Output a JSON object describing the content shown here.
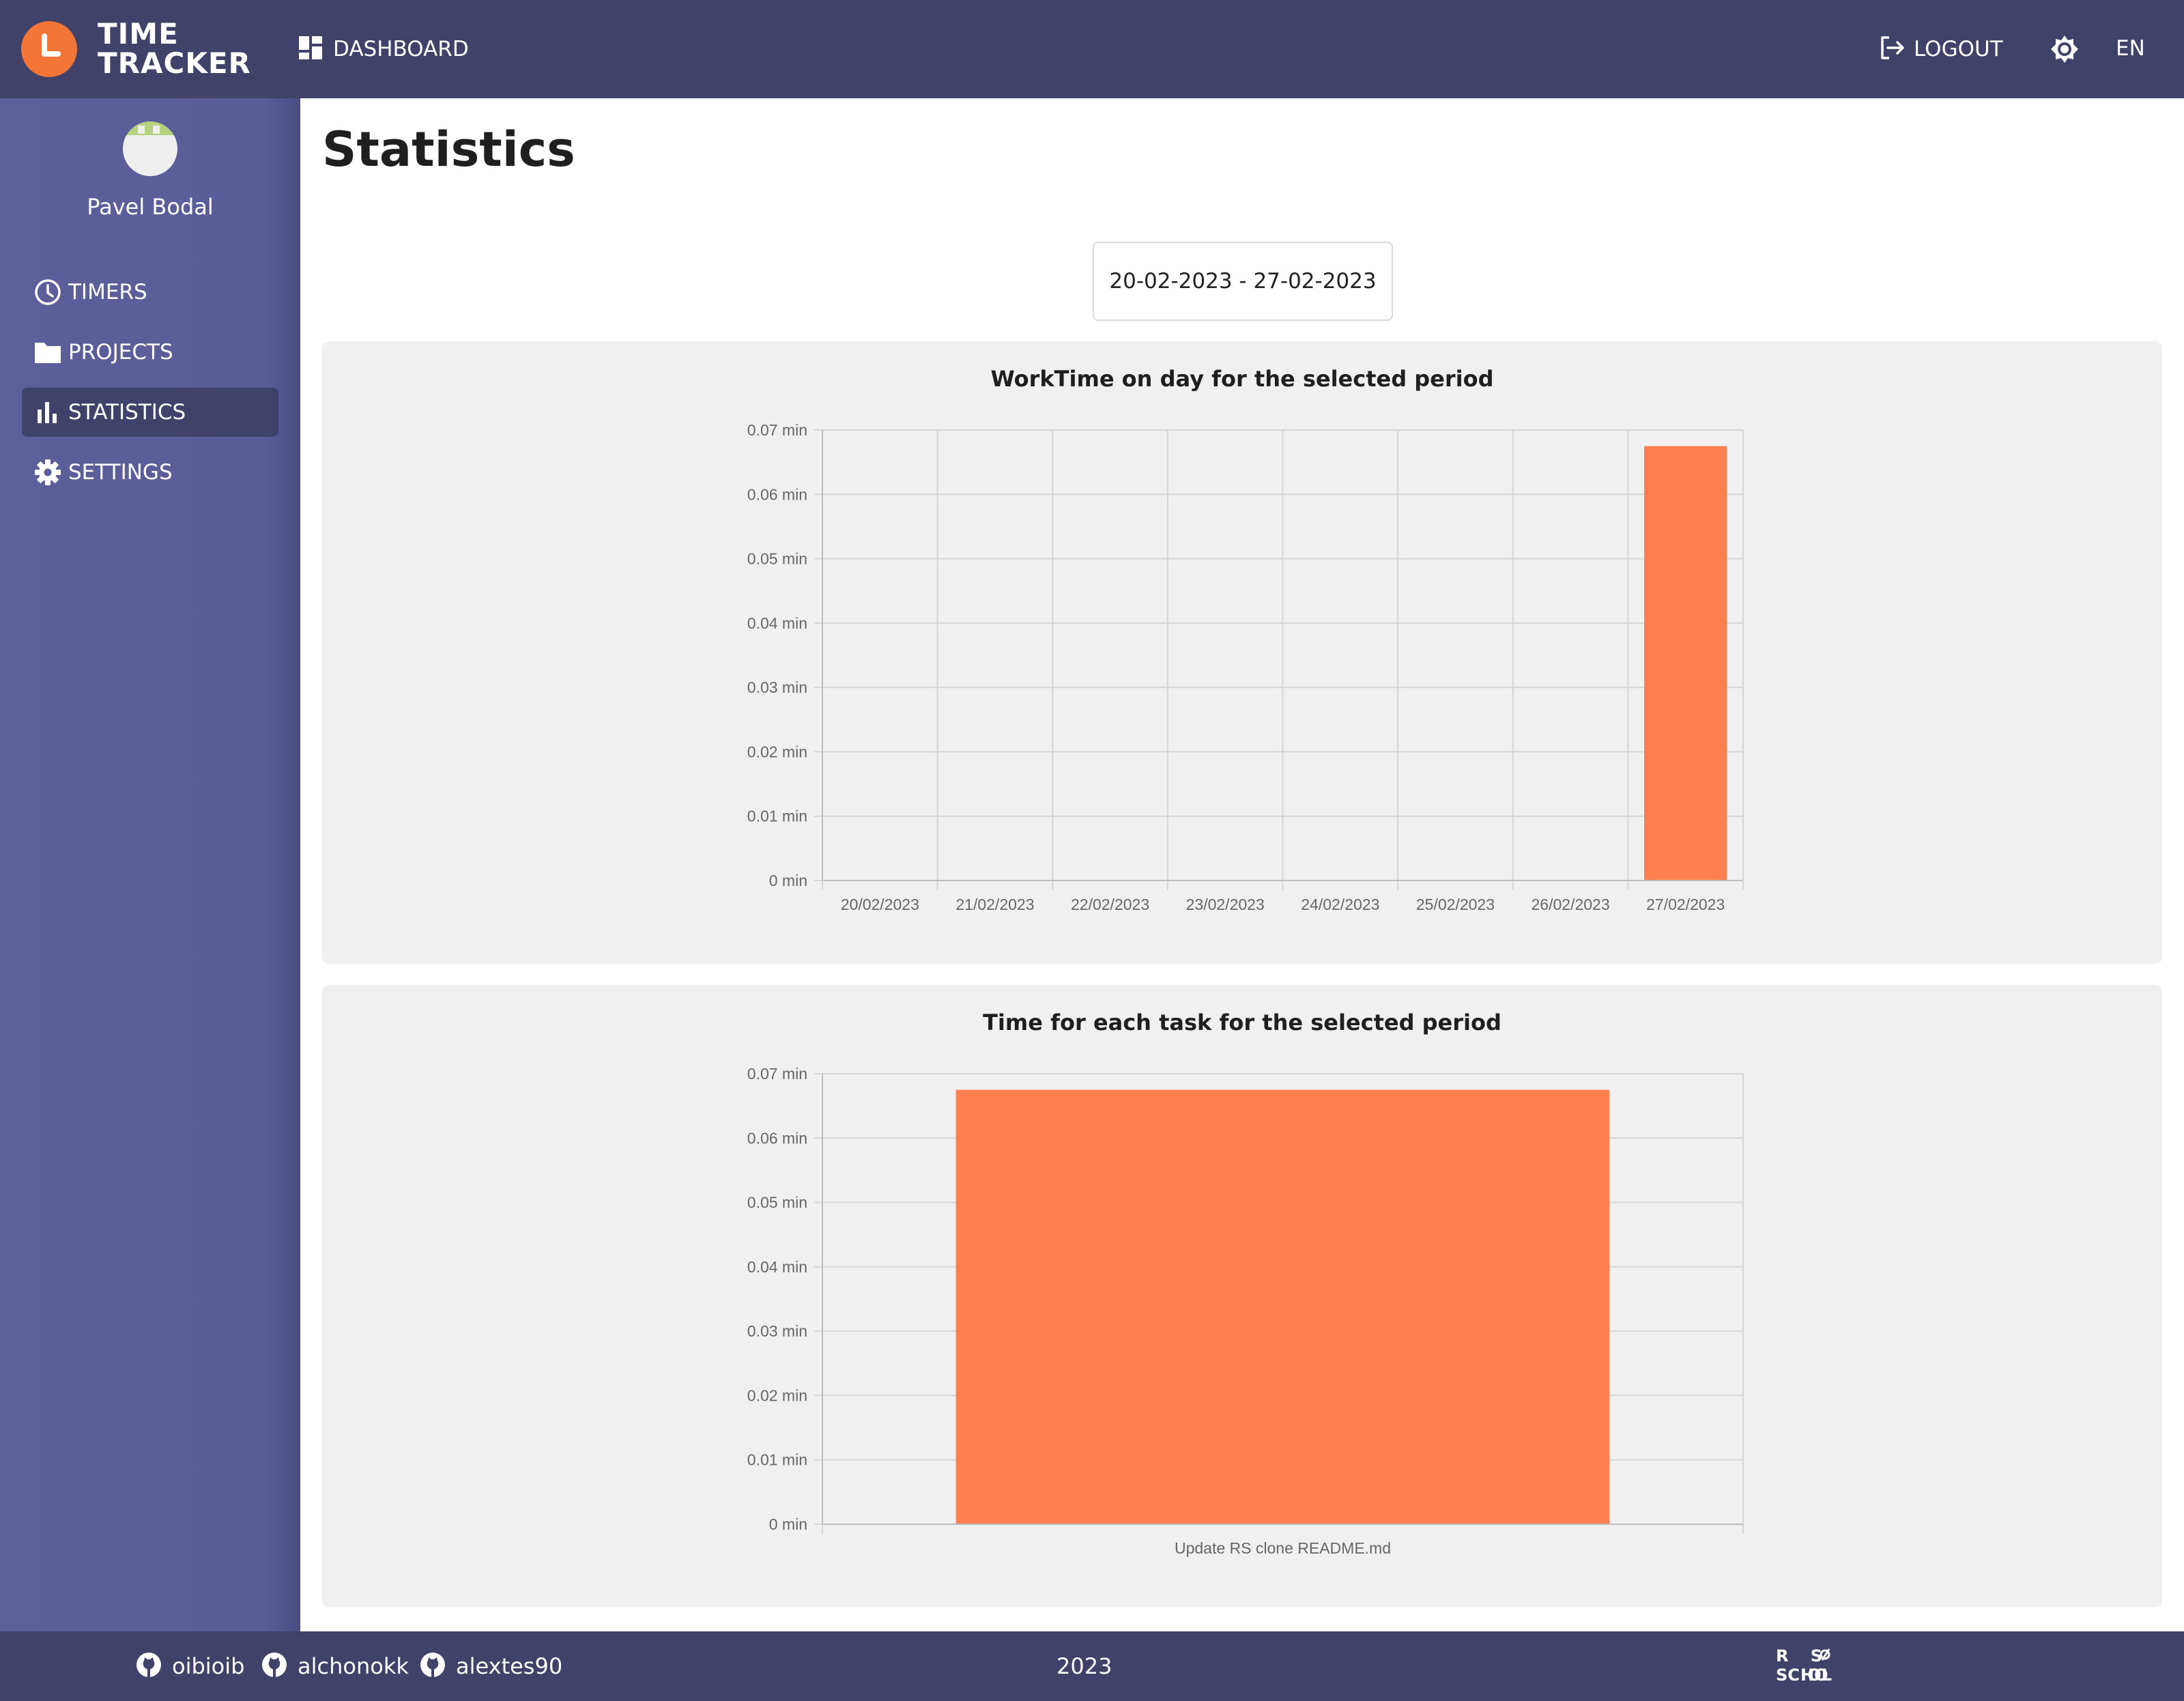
{
  "app": {
    "logo_line1": "TIME",
    "logo_line2": "TRACKER",
    "brand_color": "#f47636",
    "header_color": "#40426a"
  },
  "header": {
    "dashboard_label": "DASHBOARD",
    "logout_label": "LOGOUT",
    "language": "EN"
  },
  "sidebar": {
    "username": "Pavel Bodal",
    "items": [
      {
        "label": "TIMERS",
        "icon": "clock-icon",
        "active": false
      },
      {
        "label": "PROJECTS",
        "icon": "folder-icon",
        "active": false
      },
      {
        "label": "STATISTICS",
        "icon": "bar-chart-icon",
        "active": true
      },
      {
        "label": "SETTINGS",
        "icon": "gear-icon",
        "active": false
      }
    ]
  },
  "main": {
    "title": "Statistics",
    "date_range": "20-02-2023 - 27-02-2023"
  },
  "chart_data": [
    {
      "type": "bar",
      "title": "WorkTime on day for the selected period",
      "categories": [
        "20/02/2023",
        "21/02/2023",
        "22/02/2023",
        "23/02/2023",
        "24/02/2023",
        "25/02/2023",
        "26/02/2023",
        "27/02/2023"
      ],
      "values": [
        0,
        0,
        0,
        0,
        0,
        0,
        0,
        0.0675
      ],
      "ylim": [
        0,
        0.07
      ],
      "yticks": [
        "0 min",
        "0.01 min",
        "0.02 min",
        "0.03 min",
        "0.04 min",
        "0.05 min",
        "0.06 min",
        "0.07 min"
      ],
      "grid": true,
      "bar_color": "#ff7f50"
    },
    {
      "type": "bar",
      "title": "Time for each task for the selected period",
      "categories": [
        "Update RS clone README.md"
      ],
      "values": [
        0.0675
      ],
      "ylim": [
        0,
        0.07
      ],
      "yticks": [
        "0 min",
        "0.01 min",
        "0.02 min",
        "0.03 min",
        "0.04 min",
        "0.05 min",
        "0.06 min",
        "0.07 min"
      ],
      "grid": true,
      "bar_color": "#ff7f50"
    }
  ],
  "footer": {
    "github_users": [
      "oibioib",
      "alchonokk",
      "alextes90"
    ],
    "year": "2023",
    "school_logo_text": "RS SCHOOL"
  }
}
